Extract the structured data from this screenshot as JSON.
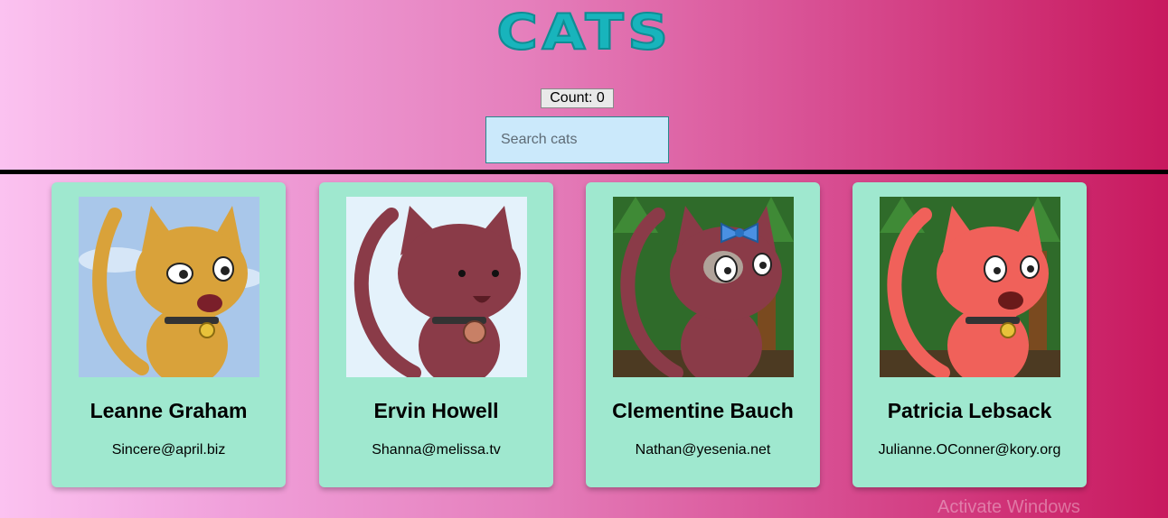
{
  "header": {
    "title": "CATS"
  },
  "counter": {
    "label": "Count: 0"
  },
  "search": {
    "placeholder": "Search cats",
    "value": ""
  },
  "cats": [
    {
      "name": "Leanne Graham",
      "email": "Sincere@april.biz",
      "fur": "#d9a23a",
      "bg": "sky"
    },
    {
      "name": "Ervin Howell",
      "email": "Shanna@melissa.tv",
      "fur": "#8a3b48",
      "bg": "snow"
    },
    {
      "name": "Clementine Bauch",
      "email": "Nathan@yesenia.net",
      "fur": "#8a3b48",
      "bg": "forest"
    },
    {
      "name": "Patricia Lebsack",
      "email": "Julianne.OConner@kory.org",
      "fur": "#f0615a",
      "bg": "forest"
    }
  ],
  "os_watermark": "Activate Windows"
}
